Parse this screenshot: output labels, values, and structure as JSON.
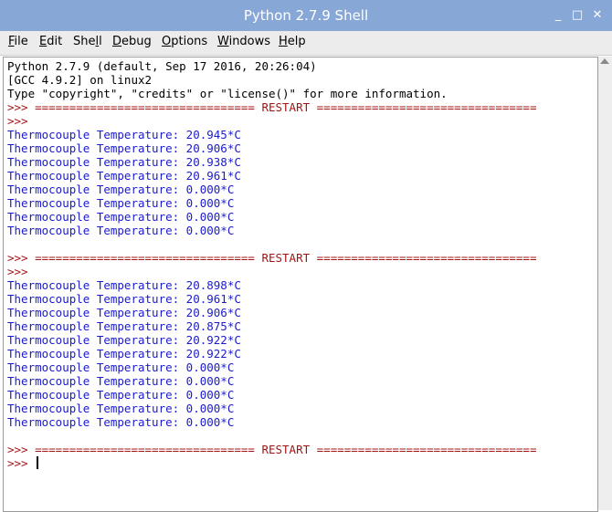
{
  "window": {
    "title": "Python 2.7.9 Shell",
    "min_glyph": "_",
    "max_glyph": "□",
    "close_glyph": "✕"
  },
  "menu": {
    "file": {
      "pre": "",
      "u": "F",
      "post": "ile"
    },
    "edit": {
      "pre": "",
      "u": "E",
      "post": "dit"
    },
    "shell": {
      "pre": "She",
      "u": "l",
      "post": "l"
    },
    "debug": {
      "pre": "",
      "u": "D",
      "post": "ebug"
    },
    "options": {
      "pre": "",
      "u": "O",
      "post": "ptions"
    },
    "windows": {
      "pre": "",
      "u": "W",
      "post": "indows"
    },
    "help": {
      "pre": "",
      "u": "H",
      "post": "elp"
    }
  },
  "shell": {
    "banner1": "Python 2.7.9 (default, Sep 17 2016, 20:26:04)",
    "banner2": "[GCC 4.9.2] on linux2",
    "banner3": "Type \"copyright\", \"credits\" or \"license()\" for more information.",
    "restart": ">>> ================================ RESTART ================================",
    "prompt": ">>> ",
    "run1": [
      "Thermocouple Temperature: 20.945*C",
      "Thermocouple Temperature: 20.906*C",
      "Thermocouple Temperature: 20.938*C",
      "Thermocouple Temperature: 20.961*C",
      "Thermocouple Temperature: 0.000*C",
      "Thermocouple Temperature: 0.000*C",
      "Thermocouple Temperature: 0.000*C",
      "Thermocouple Temperature: 0.000*C"
    ],
    "run2": [
      "Thermocouple Temperature: 20.898*C",
      "Thermocouple Temperature: 20.961*C",
      "Thermocouple Temperature: 20.906*C",
      "Thermocouple Temperature: 20.875*C",
      "Thermocouple Temperature: 20.922*C",
      "Thermocouple Temperature: 20.922*C",
      "Thermocouple Temperature: 0.000*C",
      "Thermocouple Temperature: 0.000*C",
      "Thermocouple Temperature: 0.000*C",
      "Thermocouple Temperature: 0.000*C",
      "Thermocouple Temperature: 0.000*C"
    ]
  },
  "colors": {
    "titlebar": "#87a7d6",
    "output_text": "#1a1acd",
    "prompt_text": "#a31515"
  }
}
